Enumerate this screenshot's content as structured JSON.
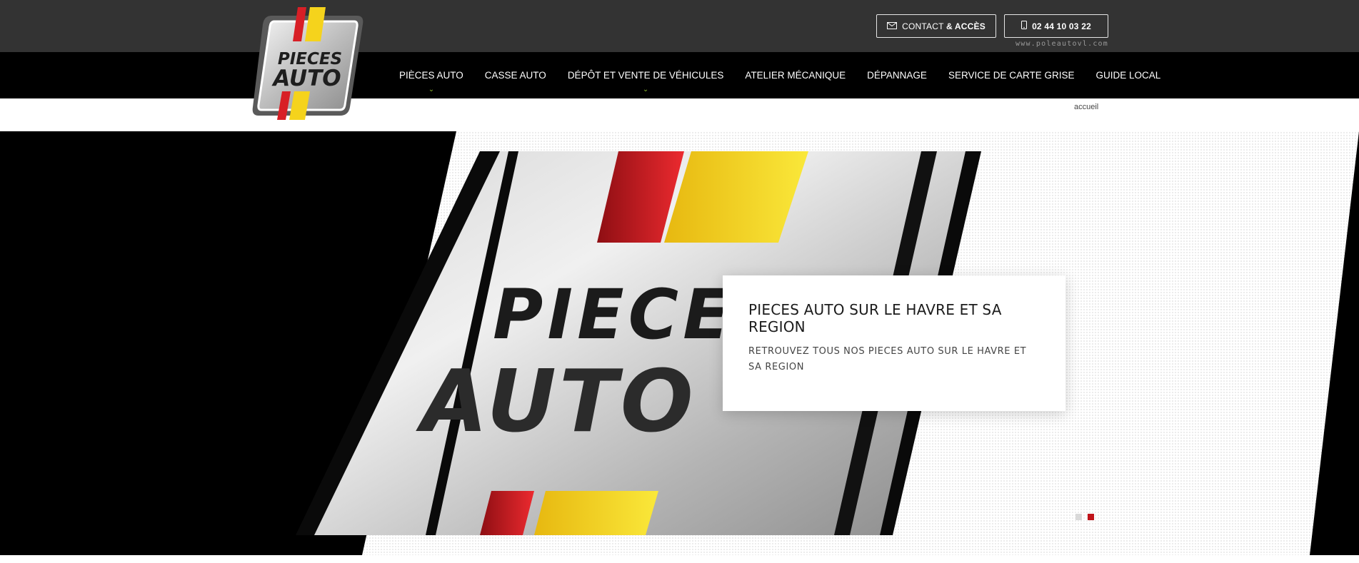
{
  "brand": {
    "logo_line1": "PIECES",
    "logo_line2": "AUTO",
    "colors": {
      "red": "#d81f26",
      "yellow": "#f5d31c",
      "green_caret": "#8ab52e",
      "topbar": "#333333",
      "navbar": "#000000"
    }
  },
  "header": {
    "contact_prefix": "CONTACT",
    "contact_suffix": "& ACCÈS",
    "contact_icon": "envelope-icon",
    "phone": "02 44 10 03 22",
    "phone_icon": "mobile-phone-icon",
    "website": "www.poleautovl.com"
  },
  "nav": {
    "items": [
      {
        "label": "PIÈCES AUTO",
        "dropdown": true
      },
      {
        "label": "CASSE AUTO",
        "dropdown": false
      },
      {
        "label": "DÉPÔT ET VENTE DE VÉHICULES",
        "dropdown": true
      },
      {
        "label": "ATELIER MÉCANIQUE",
        "dropdown": false
      },
      {
        "label": "DÉPANNAGE",
        "dropdown": false
      },
      {
        "label": "SERVICE DE CARTE GRISE",
        "dropdown": false
      },
      {
        "label": "GUIDE LOCAL",
        "dropdown": false
      }
    ],
    "caret_glyph": "⌄"
  },
  "breadcrumb": {
    "home": "accueil"
  },
  "hero": {
    "image_text_line1": "PIECES",
    "image_text_line2": "AUTO",
    "caption_title": "PIECES AUTO SUR LE HAVRE ET SA REGION",
    "caption_text": "RETROUVEZ TOUS NOS PIECES AUTO SUR LE HAVRE ET SA REGION",
    "slides": 2,
    "active_slide": 2
  }
}
